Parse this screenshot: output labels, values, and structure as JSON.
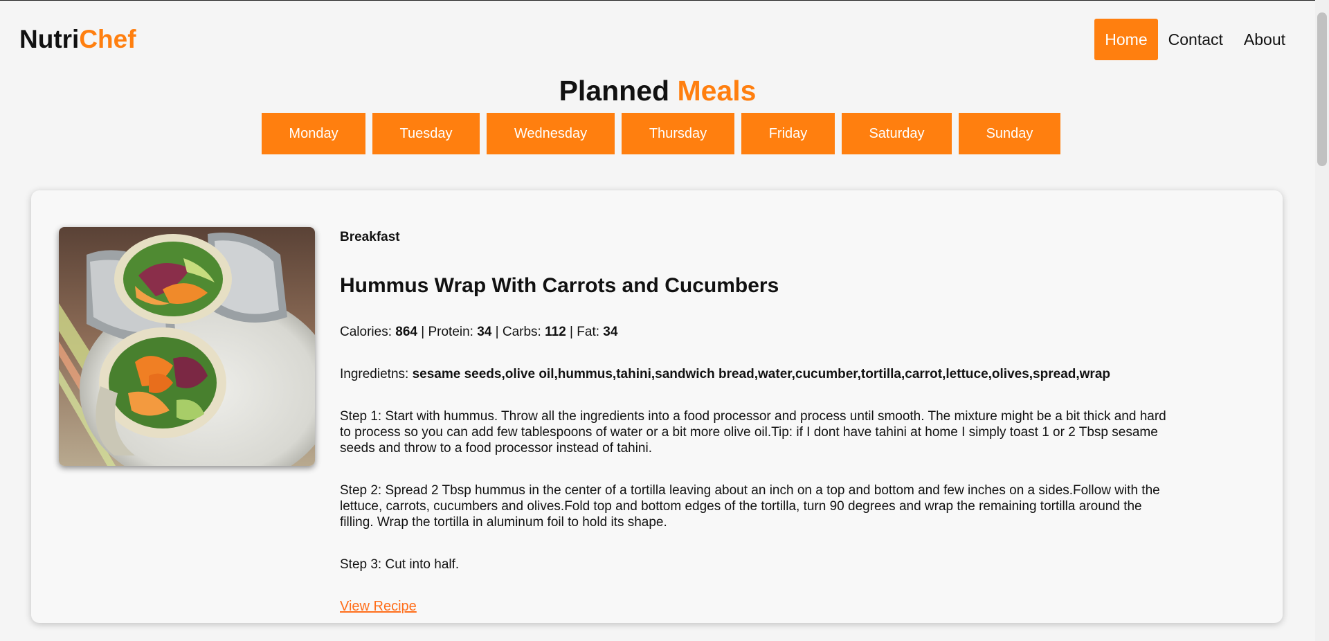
{
  "brand": {
    "part1": "Nutri",
    "part2": "Chef"
  },
  "nav": {
    "home": "Home",
    "contact": "Contact",
    "about": "About"
  },
  "title": {
    "part1": "Planned",
    "part2": "Meals"
  },
  "days": [
    "Monday",
    "Tuesday",
    "Wednesday",
    "Thursday",
    "Friday",
    "Saturday",
    "Sunday"
  ],
  "meal": {
    "type": "Breakfast",
    "title": "Hummus Wrap With Carrots and Cucumbers",
    "calories_label": "Calories:",
    "calories": "864",
    "protein_label": "Protein:",
    "protein": "34",
    "carbs_label": "Carbs:",
    "carbs": "112",
    "fat_label": "Fat:",
    "fat": "34",
    "ingredients_label": "Ingredietns:",
    "ingredients": "sesame seeds,olive oil,hummus,tahini,sandwich bread,water,cucumber,tortilla,carrot,lettuce,olives,spread,wrap",
    "steps": [
      "Step 1: Start with hummus. Throw all the ingredients into a food processor and process until smooth. The mixture might be a bit thick and hard to process so you can add few tablespoons of water or a bit more olive oil.Tip: if I dont have tahini at home I simply toast 1 or 2 Tbsp sesame seeds and throw to a food processor instead of tahini.",
      "Step 2: Spread 2 Tbsp hummus in the center of a tortilla leaving about an inch on a top and bottom and few inches on a sides.Follow with the lettuce, carrots, cucumbers and olives.Fold top and bottom edges of the tortilla, turn 90 degrees and wrap the remaining tortilla around the filling. Wrap the tortilla in aluminum foil to hold its shape.",
      "Step 3: Cut into half."
    ],
    "link": "View Recipe"
  },
  "colors": {
    "accent": "#ff7f0f",
    "background": "#f5f5f5",
    "card": "#f8f8f8"
  }
}
